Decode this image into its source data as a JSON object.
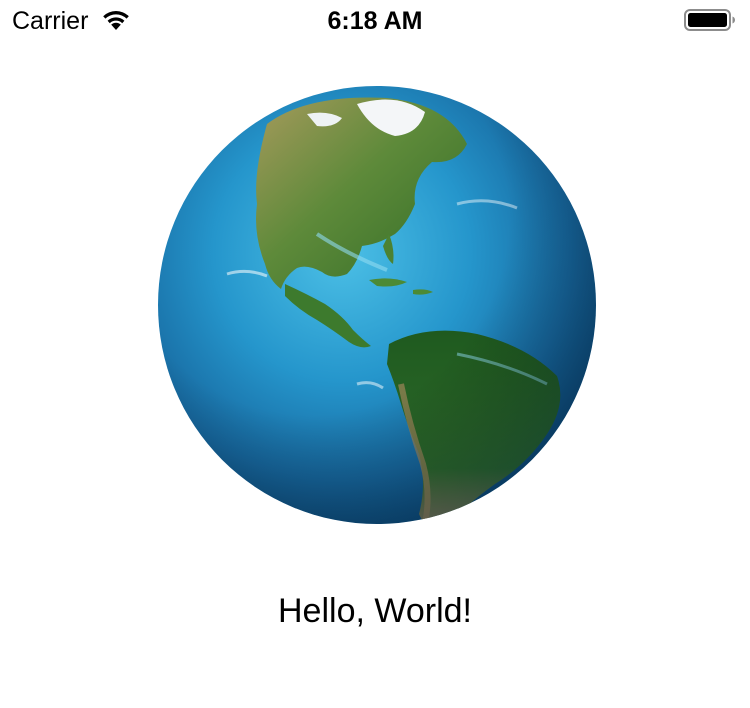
{
  "status_bar": {
    "carrier": "Carrier",
    "time": "6:18 AM",
    "wifi_icon": "wifi-icon",
    "battery_icon": "battery-icon",
    "battery_level": 1.0
  },
  "content": {
    "image_icon": "earth-globe-image",
    "greeting": "Hello, World!"
  },
  "colors": {
    "text": "#000000",
    "background": "#ffffff",
    "ocean": "#1f8ac4",
    "land": "#3f7a2a"
  }
}
